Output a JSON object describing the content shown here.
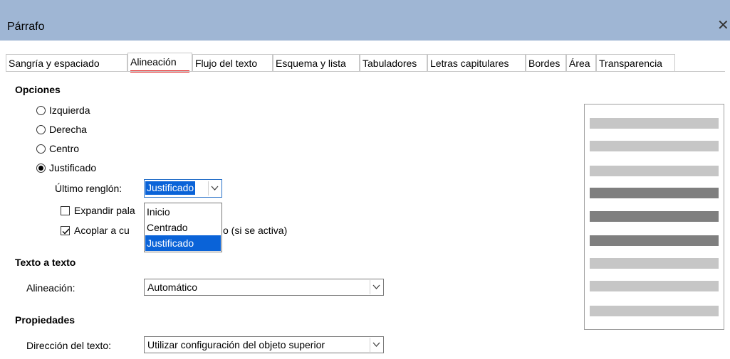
{
  "window": {
    "title": "Párrafo",
    "close_glyph": "✕"
  },
  "tabs": [
    {
      "label": "Sangría y espaciado"
    },
    {
      "label": "Alineación",
      "active": true
    },
    {
      "label": "Flujo del texto"
    },
    {
      "label": "Esquema y lista"
    },
    {
      "label": "Tabuladores"
    },
    {
      "label": "Letras capitulares"
    },
    {
      "label": "Bordes"
    },
    {
      "label": "Área"
    },
    {
      "label": "Transparencia"
    }
  ],
  "options": {
    "heading": "Opciones",
    "radios": [
      {
        "label": "Izquierda",
        "selected": false
      },
      {
        "label": "Derecha",
        "selected": false
      },
      {
        "label": "Centro",
        "selected": false
      },
      {
        "label": "Justificado",
        "selected": true
      }
    ],
    "last_line_label": "Último renglón:",
    "last_line_value": "Justificado",
    "last_line_options": [
      "Inicio",
      "Centrado",
      "Justificado"
    ],
    "expand_label_visible": "Expandir pala",
    "expand_checked": false,
    "snap_label_left": "Acoplar a cu",
    "snap_label_right": "o (si se activa)",
    "snap_checked": true
  },
  "text_to_text": {
    "heading": "Texto a texto",
    "alignment_label": "Alineación:",
    "alignment_value": "Automático"
  },
  "properties": {
    "heading": "Propiedades",
    "direction_label": "Dirección del texto:",
    "direction_value": "Utilizar configuración del objeto superior"
  },
  "colors": {
    "titlebar": "#9fb6d4",
    "selection": "#0a63d8",
    "active_tab_underline": "#e31d1d",
    "preview_light": "#c6c6c6",
    "preview_dark": "#7f7f7f"
  },
  "icons": {
    "close": "close-icon",
    "dropdown": "chevron-down-icon",
    "check": "checkmark-icon"
  }
}
